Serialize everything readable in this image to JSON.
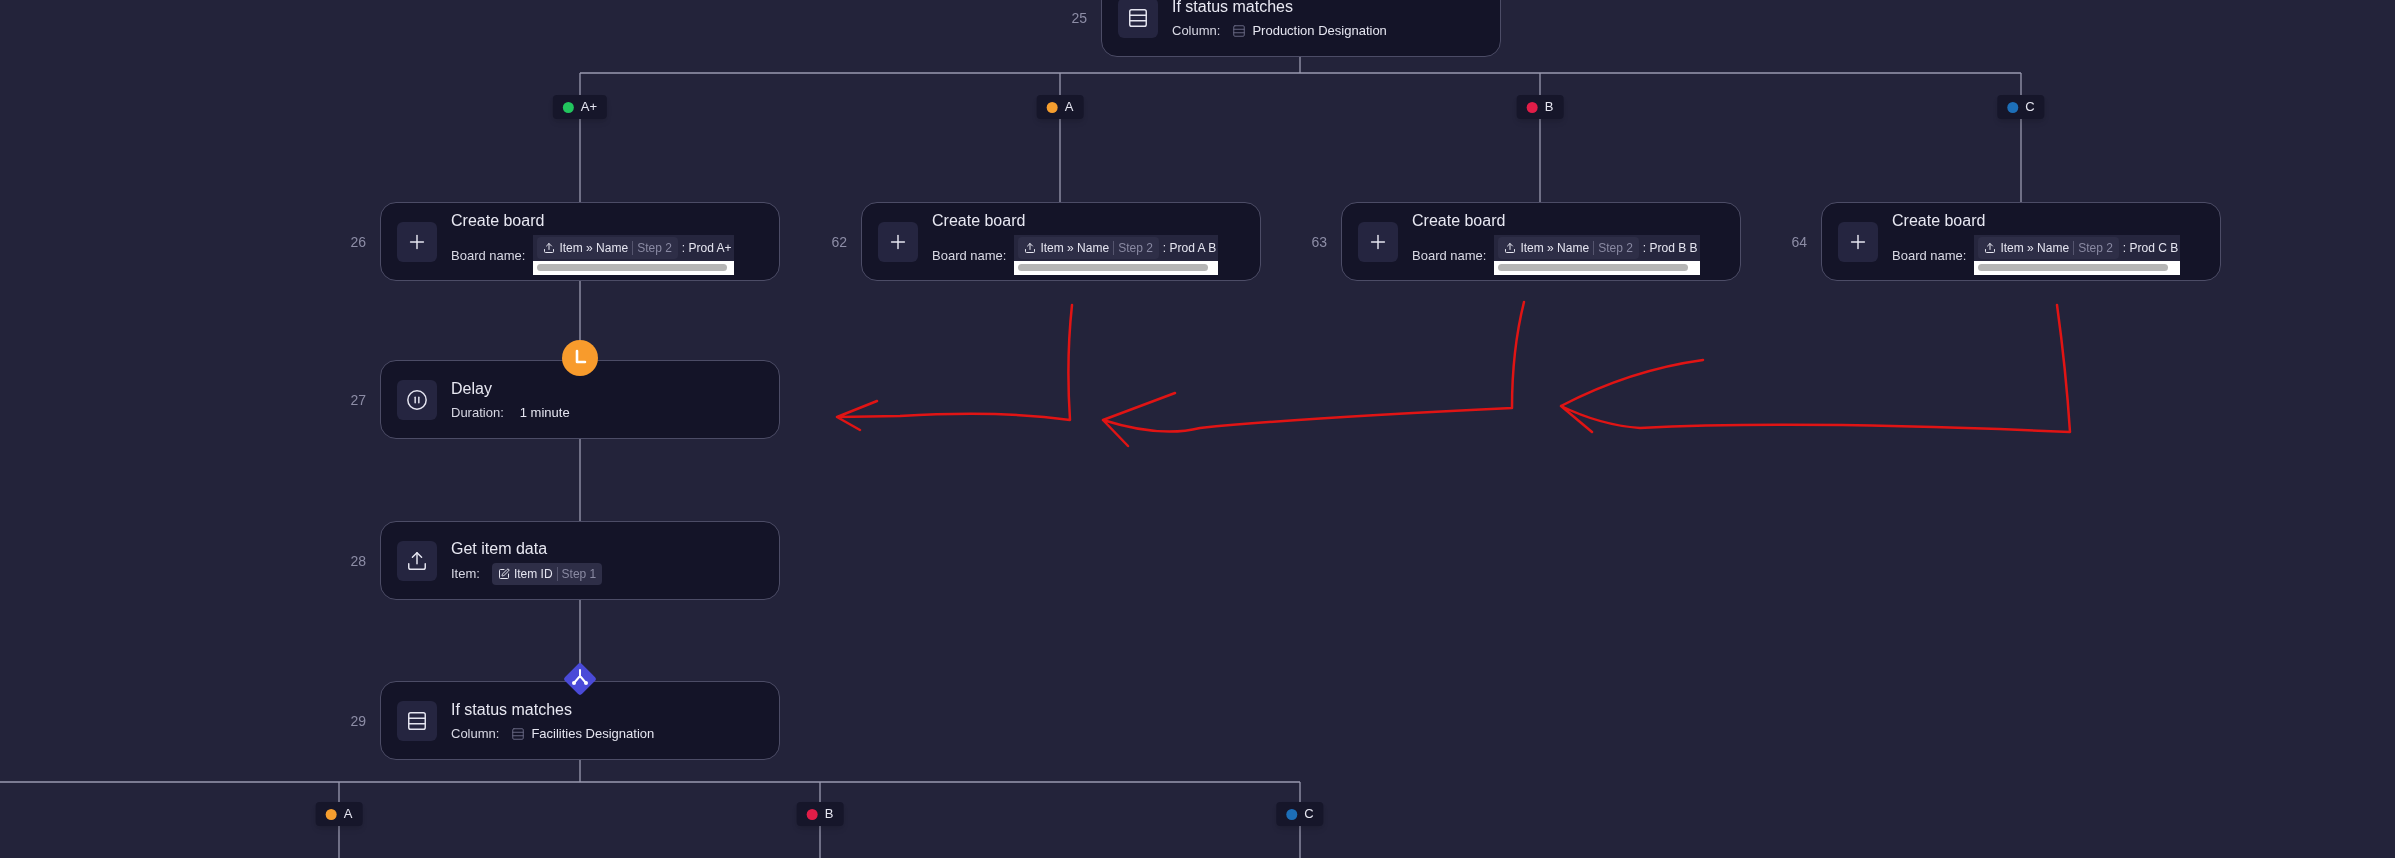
{
  "nodes": [
    {
      "number": "25",
      "kind": "condition",
      "title": "If status matches",
      "field_label": "Column:",
      "column": "Production Designation"
    },
    {
      "number": "26",
      "kind": "create_board",
      "title": "Create board",
      "field_label": "Board name:",
      "token": "Item » Name",
      "step": "Step 2",
      "suffix": ": Prod A+"
    },
    {
      "number": "62",
      "kind": "create_board",
      "title": "Create board",
      "field_label": "Board name:",
      "token": "Item » Name",
      "step": "Step 2",
      "suffix": ": Prod A B"
    },
    {
      "number": "63",
      "kind": "create_board",
      "title": "Create board",
      "field_label": "Board name:",
      "token": "Item » Name",
      "step": "Step 2",
      "suffix": ": Prod B B"
    },
    {
      "number": "64",
      "kind": "create_board",
      "title": "Create board",
      "field_label": "Board name:",
      "token": "Item » Name",
      "step": "Step 2",
      "suffix": ": Prod C B"
    },
    {
      "number": "27",
      "kind": "delay",
      "badge": true,
      "title": "Delay",
      "field_label": "Duration:",
      "value": "1 minute"
    },
    {
      "number": "28",
      "kind": "get_item",
      "title": "Get item data",
      "field_label": "Item:",
      "token": "Item ID",
      "step": "Step 1"
    },
    {
      "number": "29",
      "kind": "condition",
      "badge": true,
      "title": "If status matches",
      "field_label": "Column:",
      "column": "Facilities Designation"
    }
  ],
  "branch_groups": [
    {
      "labels": [
        {
          "label": "A+",
          "color": "#22c55e"
        },
        {
          "label": "A",
          "color": "#f59e2f"
        },
        {
          "label": "B",
          "color": "#e11d48"
        },
        {
          "label": "C",
          "color": "#1d6fb8"
        }
      ]
    },
    {
      "labels": [
        {
          "label": "A",
          "color": "#f59e2f"
        },
        {
          "label": "B",
          "color": "#e11d48"
        },
        {
          "label": "C",
          "color": "#1d6fb8"
        }
      ]
    }
  ]
}
